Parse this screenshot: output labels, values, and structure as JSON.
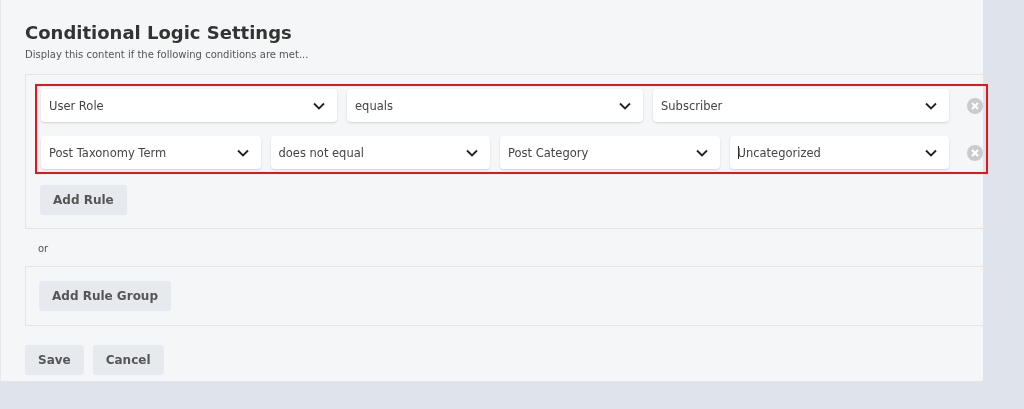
{
  "title": "Conditional Logic Settings",
  "subtitle": "Display this content if the following conditions are met...",
  "rule_groups": [
    {
      "highlighted": true,
      "rules": [
        {
          "fields": [
            {
              "value": "User Role",
              "focused": false
            },
            {
              "value": "equals",
              "focused": false
            },
            {
              "value": "Subscriber",
              "focused": false
            }
          ]
        },
        {
          "fields": [
            {
              "value": "Post Taxonomy Term",
              "focused": false
            },
            {
              "value": "does not equal",
              "focused": false
            },
            {
              "value": "Post Category",
              "focused": false
            },
            {
              "value": "Uncategorized",
              "focused": true
            }
          ]
        }
      ],
      "add_rule_button": "Add Rule"
    }
  ],
  "separator": "or",
  "add_rule_group_button": "Add Rule Group",
  "buttons": [
    "Save",
    "Cancel"
  ]
}
